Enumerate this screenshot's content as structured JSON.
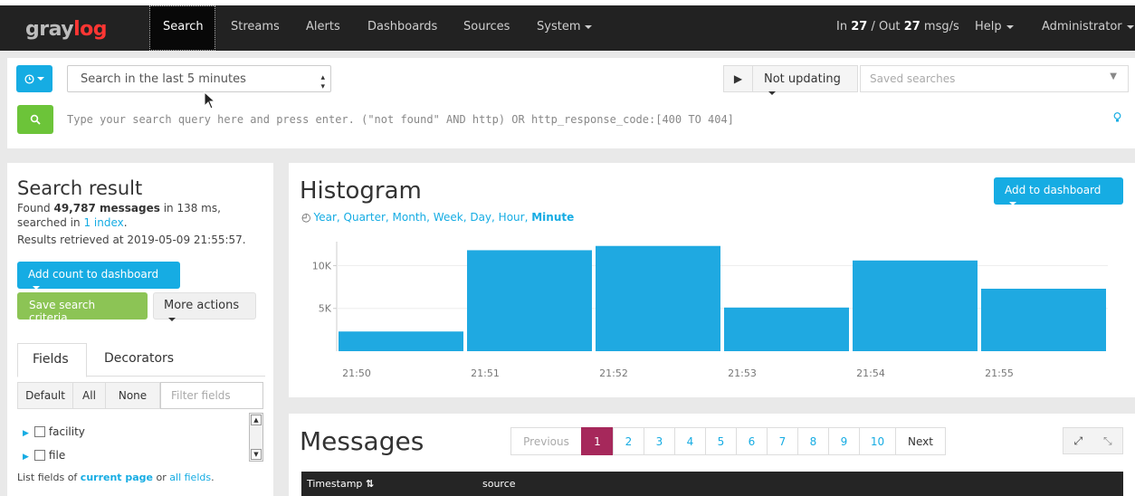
{
  "navbar": {
    "logo_left": "gray",
    "logo_right": "log",
    "items": [
      "Search",
      "Streams",
      "Alerts",
      "Dashboards",
      "Sources",
      "System"
    ],
    "throughput_in_label": "In",
    "throughput_in": "27",
    "throughput_out_label": "/ Out",
    "throughput_out": "27",
    "throughput_unit": "msg/s",
    "help": "Help",
    "user": "Administrator"
  },
  "search": {
    "range_icon": "clock-icon",
    "range_value": "Search in the last 5 minutes",
    "play_icon": "play-icon",
    "not_updating": "Not updating",
    "saved_placeholder": "Saved searches",
    "query_placeholder": "Type your search query here and press enter. (\"not found\" AND http) OR http_response_code:[400 TO 404]"
  },
  "result": {
    "title": "Search result",
    "found_prefix": "Found",
    "count": "49,787 messages",
    "found_mid": "in 138 ms, searched in",
    "index_link": "1 index",
    "found_suffix": ".",
    "retrieved": "Results retrieved at 2019-05-09 21:55:57.",
    "add_count_label": "Add count to dashboard",
    "save_label": "Save search criteria",
    "more_label": "More actions"
  },
  "fields": {
    "tabs": [
      "Fields",
      "Decorators"
    ],
    "filter_buttons": [
      "Default",
      "All",
      "None"
    ],
    "filter_placeholder": "Filter fields",
    "items": [
      "facility",
      "file"
    ],
    "list_prefix": "List fields of",
    "current_page": "current page",
    "list_mid": "or",
    "all_fields": "all fields",
    "list_suffix": "."
  },
  "histogram": {
    "title": "Histogram",
    "resolutions": [
      "Year",
      "Quarter",
      "Month",
      "Week",
      "Day",
      "Hour"
    ],
    "resolution_active": "Minute",
    "add_to_dashboard": "Add to dashboard"
  },
  "chart_data": {
    "type": "bar",
    "categories": [
      "21:50",
      "21:51",
      "21:52",
      "21:53",
      "21:54",
      "21:55"
    ],
    "values": [
      2300,
      11800,
      12300,
      5100,
      10600,
      7300
    ],
    "ylim": [
      0,
      12800
    ],
    "yticks": [
      {
        "label": "5K",
        "value": 5000
      },
      {
        "label": "10K",
        "value": 10000
      }
    ],
    "grid": true,
    "color": "#1fa9e1"
  },
  "messages": {
    "title": "Messages",
    "prev": "Previous",
    "pages": [
      "1",
      "2",
      "3",
      "4",
      "5",
      "6",
      "7",
      "8",
      "9",
      "10"
    ],
    "active_page": "1",
    "next": "Next",
    "columns": [
      "Timestamp",
      "source"
    ],
    "sort_icon": "sort-icon"
  },
  "colors": {
    "accent": "#16ace3",
    "success": "#6cc439",
    "navbar": "#222222",
    "active_page": "#a6285b"
  }
}
